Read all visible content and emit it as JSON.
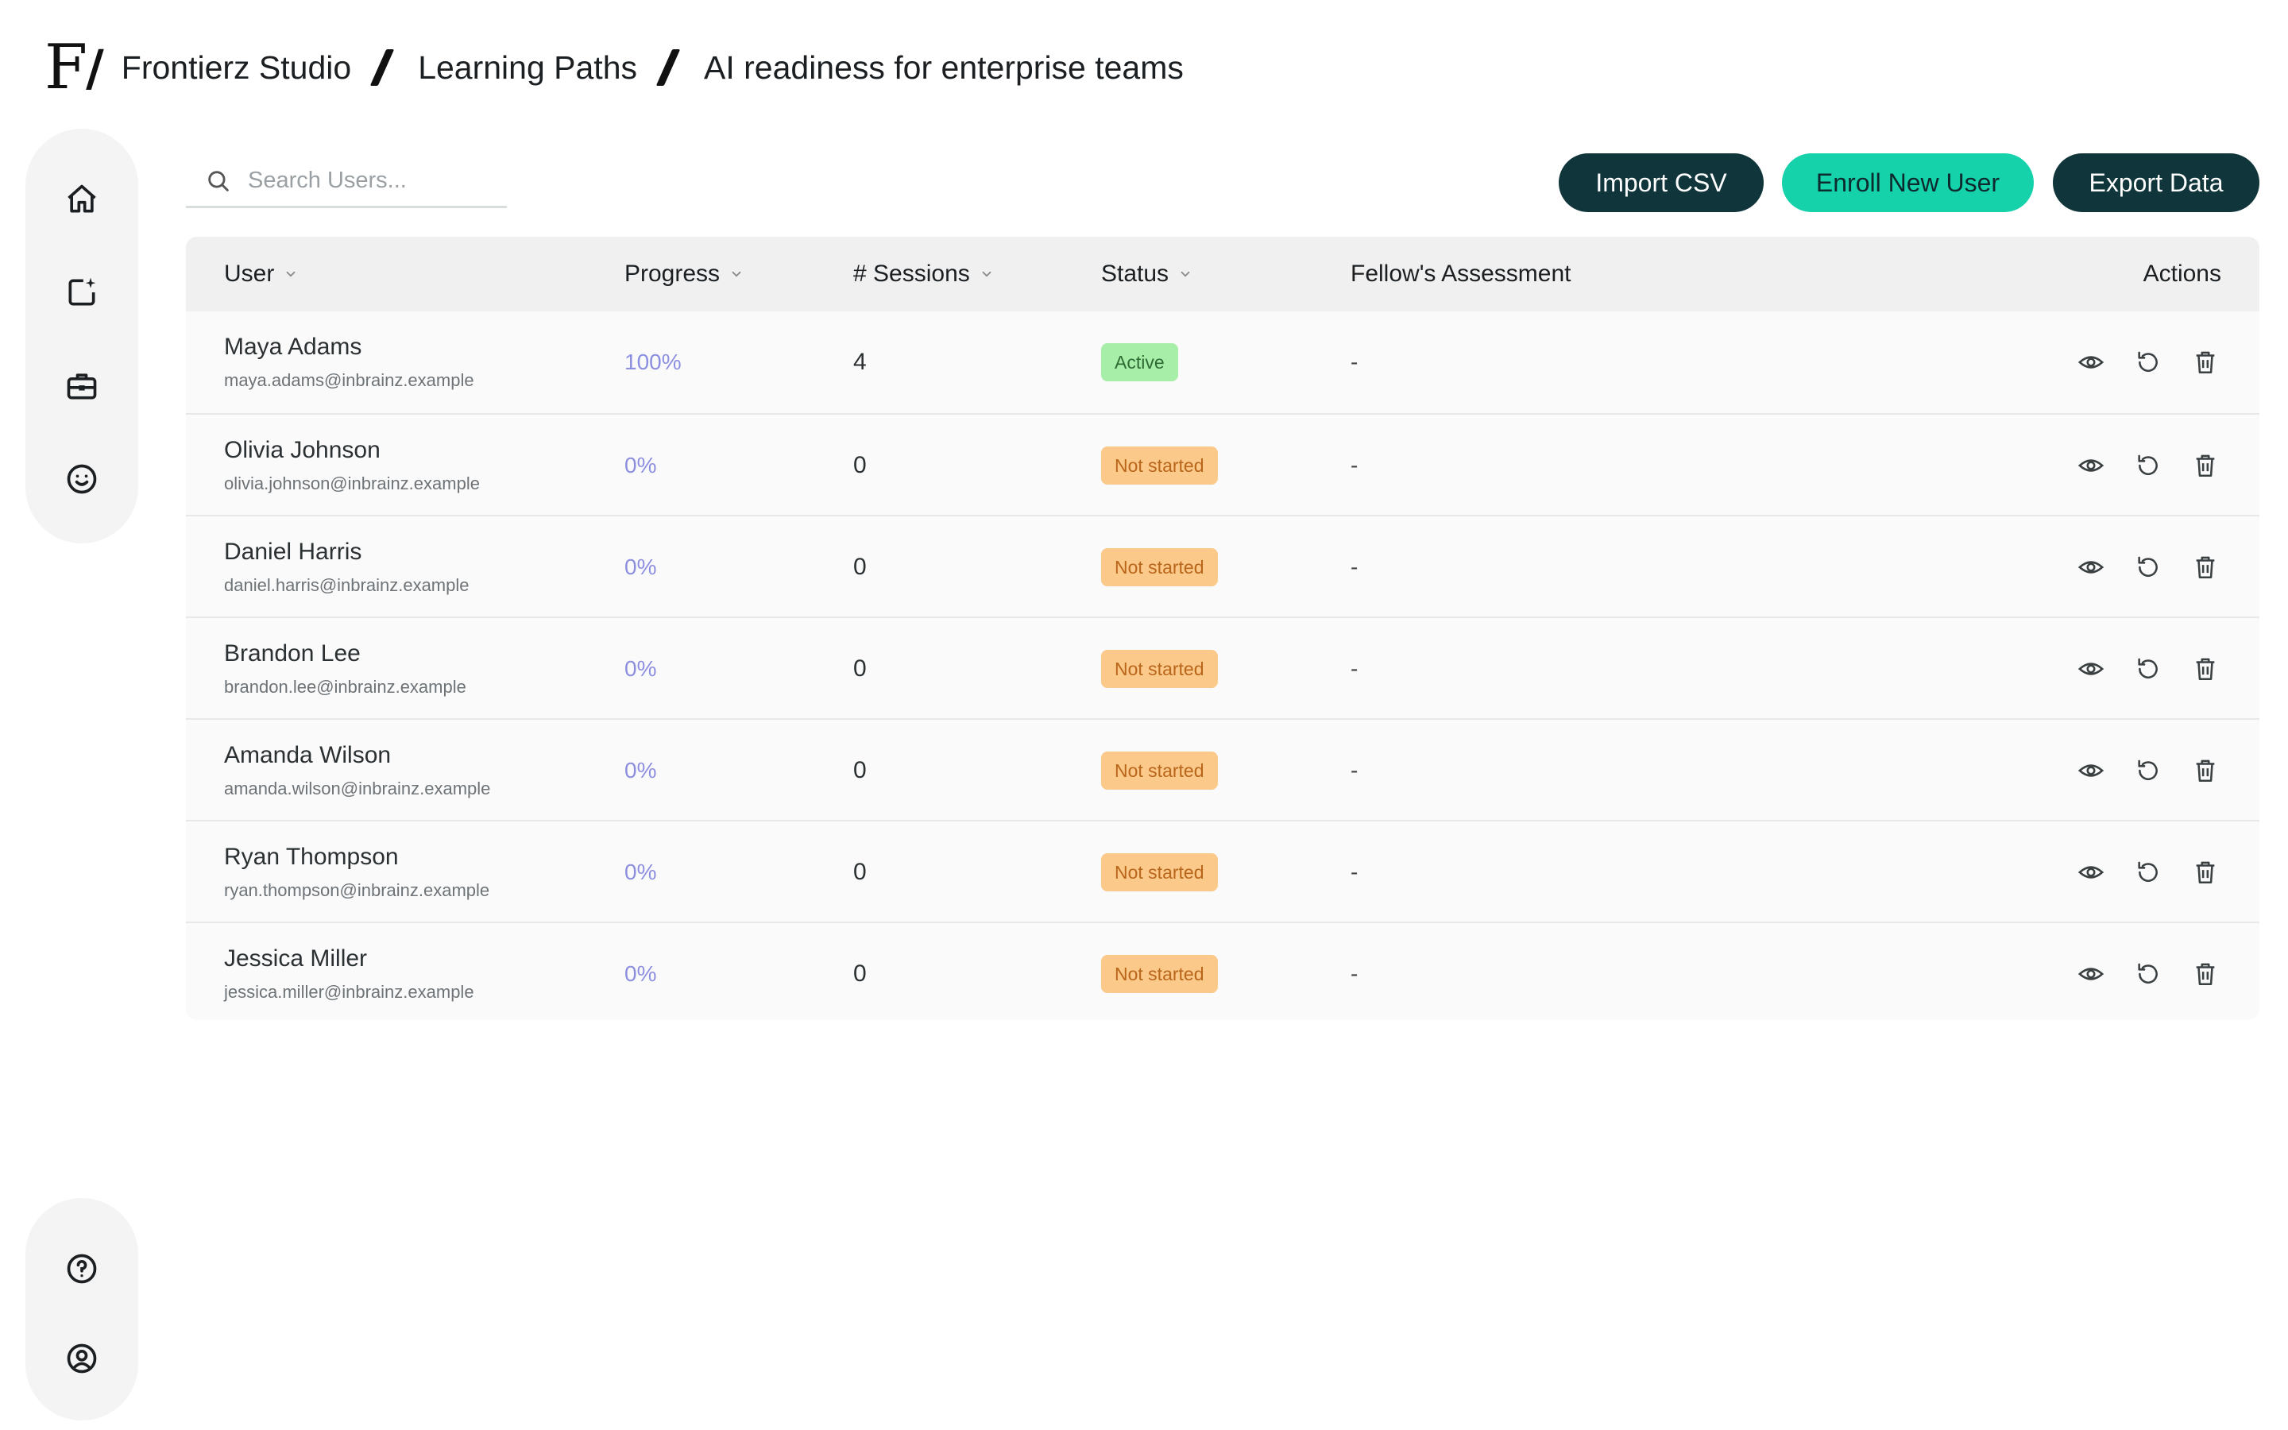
{
  "brand": {
    "logo_text": "F",
    "logo_slash": "/"
  },
  "breadcrumb": [
    "Frontierz Studio",
    "Learning Paths",
    "AI readiness for enterprise teams"
  ],
  "sidebar": {
    "top": [
      "home-icon",
      "new-document-icon",
      "briefcase-icon",
      "smile-icon"
    ],
    "bottom": [
      "help-icon",
      "account-icon"
    ]
  },
  "search": {
    "placeholder": "Search Users...",
    "value": ""
  },
  "toolbar": {
    "import_label": "Import CSV",
    "enroll_label": "Enroll New User",
    "export_label": "Export Data"
  },
  "colors": {
    "dark_button": "#10353a",
    "accent": "#16d2ab",
    "progress": "#8c8fe0",
    "active_badge": "#a7efa8",
    "not_started_badge": "#fbc98a"
  },
  "table": {
    "headers": {
      "user": "User",
      "progress": "Progress",
      "sessions": "# Sessions",
      "status": "Status",
      "assessment": "Fellow's Assessment",
      "actions": "Actions"
    },
    "rows": [
      {
        "name": "Maya Adams",
        "email": "maya.adams@inbrainz.example",
        "progress": "100%",
        "sessions": "4",
        "status": "Active",
        "status_type": "active",
        "assessment": "-"
      },
      {
        "name": "Olivia Johnson",
        "email": "olivia.johnson@inbrainz.example",
        "progress": "0%",
        "sessions": "0",
        "status": "Not started",
        "status_type": "notstarted",
        "assessment": "-"
      },
      {
        "name": "Daniel Harris",
        "email": "daniel.harris@inbrainz.example",
        "progress": "0%",
        "sessions": "0",
        "status": "Not started",
        "status_type": "notstarted",
        "assessment": "-"
      },
      {
        "name": "Brandon Lee",
        "email": "brandon.lee@inbrainz.example",
        "progress": "0%",
        "sessions": "0",
        "status": "Not started",
        "status_type": "notstarted",
        "assessment": "-"
      },
      {
        "name": "Amanda Wilson",
        "email": "amanda.wilson@inbrainz.example",
        "progress": "0%",
        "sessions": "0",
        "status": "Not started",
        "status_type": "notstarted",
        "assessment": "-"
      },
      {
        "name": "Ryan Thompson",
        "email": "ryan.thompson@inbrainz.example",
        "progress": "0%",
        "sessions": "0",
        "status": "Not started",
        "status_type": "notstarted",
        "assessment": "-"
      },
      {
        "name": "Jessica Miller",
        "email": "jessica.miller@inbrainz.example",
        "progress": "0%",
        "sessions": "0",
        "status": "Not started",
        "status_type": "notstarted",
        "assessment": "-"
      }
    ],
    "row_actions": [
      "view-icon",
      "reset-icon",
      "delete-icon"
    ]
  }
}
